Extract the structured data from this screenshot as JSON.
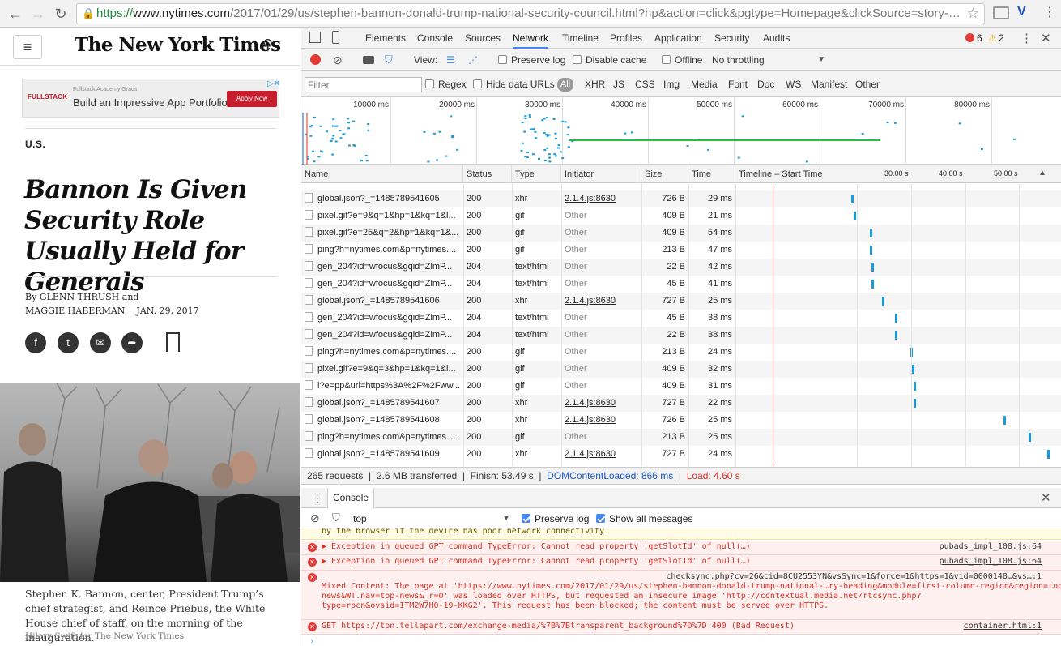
{
  "browser": {
    "url_scheme": "https://",
    "url_host": "www.nytimes.com",
    "url_path": "/2017/01/29/us/stephen-bannon-donald-trump-national-security-council.html?hp&action=click&pgtype=Homepage&clickSource=story-…",
    "back_icon": "back-arrow-icon",
    "forward_icon": "forward-arrow-icon",
    "reload_icon": "reload-icon"
  },
  "article": {
    "logo": "The New York Times",
    "ad": {
      "brand": "FULLSTACK",
      "small": "Fullstack Academy Grads",
      "headline": "Build an Impressive App Portfolio",
      "button": "Apply Now"
    },
    "section": "U.S.",
    "headline": "Bannon Is Given Security Role Usually Held for Generals",
    "byline_line1": "By GLENN THRUSH and",
    "byline_line2": "MAGGIE HABERMAN    JAN. 29, 2017",
    "caption": "Stephen K. Bannon, center, President Trump’s chief strategist, and Reince Priebus, the White House chief of staff, on the morning of the inauguration.",
    "credit": "Hilary Swift for The New York Times"
  },
  "devtools": {
    "tabs": [
      "Elements",
      "Console",
      "Sources",
      "Network",
      "Timeline",
      "Profiles",
      "Application",
      "Security",
      "Audits"
    ],
    "active_tab": "Network",
    "error_count": "6",
    "warning_count": "2",
    "toolbar": {
      "view_label": "View:",
      "preserve_log": "Preserve log",
      "disable_cache": "Disable cache",
      "offline": "Offline",
      "throttling": "No throttling"
    },
    "filter": {
      "placeholder": "Filter",
      "regex": "Regex",
      "hide_data_urls": "Hide data URLs",
      "all": "All",
      "types": [
        "XHR",
        "JS",
        "CSS",
        "Img",
        "Media",
        "Font",
        "Doc",
        "WS",
        "Manifest",
        "Other"
      ]
    },
    "overview_ticks": [
      "10000 ms",
      "20000 ms",
      "30000 ms",
      "40000 ms",
      "50000 ms",
      "60000 ms",
      "70000 ms",
      "80000 ms",
      "900"
    ],
    "columns": {
      "name": "Name",
      "status": "Status",
      "type": "Type",
      "initiator": "Initiator",
      "size": "Size",
      "time": "Time",
      "timeline": "Timeline – Start Time",
      "t30": "30.00 s",
      "t40": "40.00 s",
      "t50": "50.00 s"
    },
    "requests": [
      {
        "name": "global.json?_=1485789541605",
        "status": "200",
        "type": "xhr",
        "initiator": "2.1.4.js:8630",
        "init_link": true,
        "size": "726 B",
        "time": "29 ms",
        "bar": 0.36
      },
      {
        "name": "pixel.gif?e=9&q=1&hp=1&kq=1&l...",
        "status": "200",
        "type": "gif",
        "initiator": "Other",
        "init_link": false,
        "size": "409 B",
        "time": "21 ms",
        "bar": 0.37
      },
      {
        "name": "pixel.gif?e=25&q=2&hp=1&kq=1&...",
        "status": "200",
        "type": "gif",
        "initiator": "Other",
        "init_link": false,
        "size": "409 B",
        "time": "54 ms",
        "bar": 0.42
      },
      {
        "name": "ping?h=nytimes.com&p=nytimes....",
        "status": "200",
        "type": "gif",
        "initiator": "Other",
        "init_link": false,
        "size": "213 B",
        "time": "47 ms",
        "bar": 0.42
      },
      {
        "name": "gen_204?id=wfocus&gqid=ZlmP...",
        "status": "204",
        "type": "text/html",
        "initiator": "Other",
        "init_link": false,
        "size": "22 B",
        "time": "42 ms",
        "bar": 0.425
      },
      {
        "name": "gen_204?id=wfocus&gqid=ZlmP...",
        "status": "204",
        "type": "text/html",
        "initiator": "Other",
        "init_link": false,
        "size": "45 B",
        "time": "41 ms",
        "bar": 0.425
      },
      {
        "name": "global.json?_=1485789541606",
        "status": "200",
        "type": "xhr",
        "initiator": "2.1.4.js:8630",
        "init_link": true,
        "size": "727 B",
        "time": "25 ms",
        "bar": 0.46
      },
      {
        "name": "gen_204?id=wfocus&gqid=ZlmP...",
        "status": "204",
        "type": "text/html",
        "initiator": "Other",
        "init_link": false,
        "size": "45 B",
        "time": "38 ms",
        "bar": 0.5
      },
      {
        "name": "gen_204?id=wfocus&gqid=ZlmP...",
        "status": "204",
        "type": "text/html",
        "initiator": "Other",
        "init_link": false,
        "size": "22 B",
        "time": "38 ms",
        "bar": 0.5
      },
      {
        "name": "ping?h=nytimes.com&p=nytimes....",
        "status": "200",
        "type": "gif",
        "initiator": "Other",
        "init_link": false,
        "size": "213 B",
        "time": "24 ms",
        "bar": 0.55
      },
      {
        "name": "pixel.gif?e=9&q=3&hp=1&kq=1&l...",
        "status": "200",
        "type": "gif",
        "initiator": "Other",
        "init_link": false,
        "size": "409 B",
        "time": "32 ms",
        "bar": 0.555
      },
      {
        "name": "l?e=pp&url=https%3A%2F%2Fww...",
        "status": "200",
        "type": "gif",
        "initiator": "Other",
        "init_link": false,
        "size": "409 B",
        "time": "31 ms",
        "bar": 0.56
      },
      {
        "name": "global.json?_=1485789541607",
        "status": "200",
        "type": "xhr",
        "initiator": "2.1.4.js:8630",
        "init_link": true,
        "size": "727 B",
        "time": "22 ms",
        "bar": 0.56
      },
      {
        "name": "global.json?_=1485789541608",
        "status": "200",
        "type": "xhr",
        "initiator": "2.1.4.js:8630",
        "init_link": true,
        "size": "726 B",
        "time": "25 ms",
        "bar": 0.85
      },
      {
        "name": "ping?h=nytimes.com&p=nytimes....",
        "status": "200",
        "type": "gif",
        "initiator": "Other",
        "init_link": false,
        "size": "213 B",
        "time": "25 ms",
        "bar": 0.93
      },
      {
        "name": "global.json?_=1485789541609",
        "status": "200",
        "type": "xhr",
        "initiator": "2.1.4.js:8630",
        "init_link": true,
        "size": "727 B",
        "time": "24 ms",
        "bar": 0.99
      }
    ],
    "status_bar": {
      "requests": "265 requests",
      "transferred": "2.6 MB transferred",
      "finish": "Finish: 53.49 s",
      "dcl": "DOMContentLoaded: 866 ms",
      "load": "Load: 4.60 s"
    },
    "console": {
      "tab": "Console",
      "context": "top",
      "preserve_log": "Preserve log",
      "show_all": "Show all messages",
      "partial_line": "by the browser if the device has poor network connectivity.",
      "messages": [
        {
          "text": "▶ Exception in queued GPT command TypeError: Cannot read property 'getSlotId' of null(…)",
          "source": "pubads_impl_108.js:64"
        },
        {
          "text": "▶ Exception in queued GPT command TypeError: Cannot read property 'getSlotId' of null(…)",
          "source": "pubads_impl_108.js:64"
        },
        {
          "text": "Mixed Content: The page at 'https://www.nytimes.com/2017/01/29/us/stephen-bannon-donald-trump-national-…ry-heading&module=first-column-region&region=top-\nnews&WT.nav=top-news&_r=0' was loaded over HTTPS, but requested an insecure image 'http://contextual.media.net/rtcsync.php?\ntype=rbcn&ovsid=ITM2W7H0-19-KKG2'. This request has been blocked; the content must be served over HTTPS.",
          "source": "checksync.php?cv=26&cid=8CU2553YN&vsSync=1&force=1&https=1&vid=0000148…&vs…:1"
        },
        {
          "text": "GET https://ton.tellapart.com/exchange-media/%7B%7Btransparent_background%7D%7D 400 (Bad Request)",
          "source": "container.html:1"
        }
      ]
    }
  }
}
